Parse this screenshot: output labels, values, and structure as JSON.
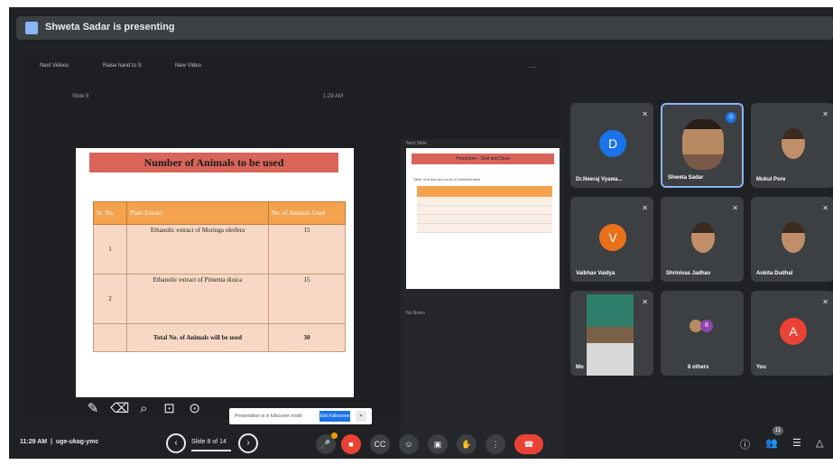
{
  "banner": {
    "text": "Shweta Sadar is presenting"
  },
  "presentation": {
    "toolbar": {
      "item1": "Next Videos",
      "item2": "Raise hand to S",
      "item3": "New Video"
    },
    "slide_label": "Slide 8",
    "time_label": "1:29 AM",
    "slide": {
      "title": "Number of Animals to be used",
      "columns": [
        "Sr. No.",
        "Plant Extract",
        "No. of Animals Used"
      ],
      "rows": [
        {
          "no": "1",
          "extract": "Ethanolic extract of Moringa oleifera",
          "count": "15"
        },
        {
          "no": "2",
          "extract": "Ethanolic extract of Pimenta dioica",
          "count": "15"
        }
      ],
      "total_label": "Total No. of Animals will be used",
      "total_value": "30"
    },
    "tools": {
      "pen": "✎",
      "eraser": "⌫",
      "zoom": "⌕",
      "laser": "⊡",
      "more": "⊙"
    },
    "notice": {
      "text": "Presentation is in fullscreen mode",
      "button": "Exit Fullscreen",
      "close": "✕"
    },
    "nav": {
      "prev": "‹",
      "label": "Slide 8 of 14",
      "next": "›"
    },
    "thumb_label": "Next Slide",
    "thumb_title": "Procedure - Oral and Dose",
    "thumb_text": "Table of doses and route of administration",
    "notes_label": "No Notes"
  },
  "participants": [
    {
      "name": "Dr.Neeraj Vyawa...",
      "avatar": "D",
      "color": "#1a73e8"
    },
    {
      "name": "Shweta Sadar",
      "active": true
    },
    {
      "name": "Mukul Pore"
    },
    {
      "name": "Vaibhav Vaidya",
      "avatar": "V",
      "color": "#e8711a"
    },
    {
      "name": "Shrinivas Jadhav"
    },
    {
      "name": "Ankita Dudhal"
    },
    {
      "name": "Mo"
    },
    {
      "name": "8 others",
      "extra": "8"
    },
    {
      "name": "You",
      "avatar": "A",
      "color": "#ea4335"
    }
  ],
  "bottombar": {
    "time": "11:29 AM",
    "separator": "|",
    "meeting_code": "uge-ukag-ymc",
    "controls": {
      "mic": "🎤",
      "camera": "■",
      "captions": "CC",
      "emoji": "☺",
      "present": "▣",
      "raise": "✋",
      "more": "⋮",
      "hangup": "☎"
    },
    "right": {
      "info": "ⓘ",
      "people": "👥",
      "chat": "☰",
      "activities": "△",
      "people_count": "11"
    }
  }
}
